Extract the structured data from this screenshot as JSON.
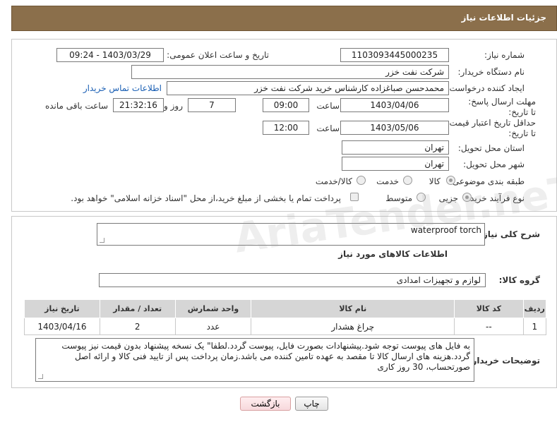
{
  "page": {
    "title": "جزئیات اطلاعات نیاز"
  },
  "form": {
    "need_number_label": "شماره نیاز:",
    "need_number": "1103093445000235",
    "announce_label": "تاریخ و ساعت اعلان عمومی:",
    "announce_value": "1403/03/29 - 09:24",
    "buyer_org_label": "نام دستگاه خریدار:",
    "buyer_org": "شرکت نفت خزر",
    "creator_label": "ایجاد کننده درخواست:",
    "creator": "محمدحسن صباغزاده کارشناس خرید شرکت نفت خزر",
    "contact_link": "اطلاعات تماس خریدار",
    "reply_deadline_label": "مهلت ارسال پاسخ: تا تاریخ:",
    "reply_date": "1403/04/06",
    "time_label": "ساعت",
    "reply_time": "09:00",
    "days_value": "7",
    "days_label": "روز و",
    "remaining_time": "21:32:16",
    "remaining_label": "ساعت باقی مانده",
    "validity_label": "حداقل تاریخ اعتبار قیمت: تا تاریخ:",
    "validity_date": "1403/05/06",
    "validity_time": "12:00",
    "province_label": "استان محل تحویل:",
    "province": "تهران",
    "city_label": "شهر محل تحویل:",
    "city": "تهران",
    "category_label": "طبقه بندی موضوعی:",
    "category_options": [
      "کالا",
      "خدمت",
      "کالا/خدمت"
    ],
    "process_label": "نوع فرآیند خرید :",
    "process_options": [
      "جزیی",
      "متوسط"
    ],
    "payment_note": "پرداخت تمام یا بخشی از مبلغ خرید،از محل \"اسناد خزانه اسلامی\" خواهد بود."
  },
  "details": {
    "summary_label": "شرح کلی نیاز:",
    "summary": "waterproof torch",
    "goods_info_title": "اطلاعات کالاهای مورد نیاز",
    "group_label": "گروه کالا:",
    "group": "لوازم و تجهیزات امدادی",
    "table": {
      "headers": [
        "ردیف",
        "کد کالا",
        "نام کالا",
        "واحد شمارش",
        "تعداد / مقدار",
        "تاریخ نیاز"
      ],
      "rows": [
        [
          "1",
          "--",
          "چراغ هشدار",
          "عدد",
          "2",
          "1403/04/16"
        ]
      ]
    },
    "buyer_notes_label": "توضیحات خریدار:",
    "buyer_notes": "به فایل های پیوست توجه شود.پیشنهادات بصورت فایل، پیوست گردد.لطفا\" یک نسخه پیشنهاد بدون قیمت نیز پیوست گردد.هزینه های ارسال کالا تا مقصد به عهده تامین کننده می باشد.زمان پرداخت پس از تایید فنی کالا و ارائه اصل صورتحساب، 30 روز کاری"
  },
  "buttons": {
    "print": "چاپ",
    "back": "بازگشت"
  },
  "watermark": "AriaTender.neT"
}
